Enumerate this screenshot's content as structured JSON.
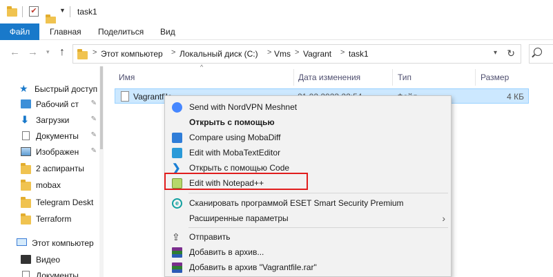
{
  "window": {
    "title": "task1"
  },
  "ribbon": {
    "tabs": [
      "Файл",
      "Главная",
      "Поделиться",
      "Вид"
    ]
  },
  "address": {
    "crumbs": [
      "Этот компьютер",
      "Локальный диск (C:)",
      "Vms",
      "Vagrant",
      "task1"
    ]
  },
  "sidebar": {
    "items": [
      {
        "label": "Быстрый доступ",
        "icon": "star-icon",
        "pinned": false
      },
      {
        "label": "Рабочий ст",
        "icon": "desktop-icon",
        "pinned": true
      },
      {
        "label": "Загрузки",
        "icon": "download-icon",
        "pinned": true
      },
      {
        "label": "Документы",
        "icon": "document-icon",
        "pinned": true
      },
      {
        "label": "Изображен",
        "icon": "image-icon",
        "pinned": true
      },
      {
        "label": "2 аспиранты",
        "icon": "folder-icon",
        "pinned": false
      },
      {
        "label": "mobax",
        "icon": "folder-icon",
        "pinned": false
      },
      {
        "label": "Telegram Deskt",
        "icon": "folder-icon",
        "pinned": false
      },
      {
        "label": "Terraform",
        "icon": "folder-icon",
        "pinned": false
      },
      {
        "label": "Этот компьютер",
        "icon": "computer-icon",
        "pinned": false
      },
      {
        "label": "Видео",
        "icon": "video-icon",
        "pinned": false
      },
      {
        "label": "Документы",
        "icon": "document-icon",
        "pinned": false
      }
    ],
    "pin_glyph": "📌"
  },
  "columns": {
    "name": "Имя",
    "date": "Дата изменения",
    "type": "Тип",
    "size": "Размер"
  },
  "files": [
    {
      "name": "Vagrantfile",
      "date": "21.02.2023 22:54",
      "type": "Файл",
      "size": "4 КБ"
    }
  ],
  "context_menu": {
    "items": [
      {
        "label": "Send with NordVPN Meshnet",
        "icon": "nordvpn-icon",
        "bold": false
      },
      {
        "label": "Открыть с помощью",
        "icon": "",
        "bold": true
      },
      {
        "label": "Compare using MobaDiff",
        "icon": "mobadiff-icon",
        "bold": false
      },
      {
        "label": "Edit with MobaTextEditor",
        "icon": "mobatexteditor-icon",
        "bold": false
      },
      {
        "label": "Открыть с помощью Code",
        "icon": "vscode-icon",
        "bold": false
      },
      {
        "label": "Edit with Notepad++",
        "icon": "notepadpp-icon",
        "bold": false,
        "highlighted": true
      },
      {
        "label": "Сканировать программой ESET Smart Security Premium",
        "icon": "eset-icon",
        "bold": false
      },
      {
        "label": "Расширенные параметры",
        "icon": "",
        "bold": false,
        "submenu": true
      },
      {
        "label": "Отправить",
        "icon": "share-icon",
        "bold": false
      },
      {
        "label": "Добавить в архив...",
        "icon": "winrar-icon",
        "bold": false
      },
      {
        "label": "Добавить в архив \"Vagrantfile.rar\"",
        "icon": "winrar-icon",
        "bold": false
      }
    ],
    "highlight_color": "#e11d1d"
  },
  "colors": {
    "accent": "#1979ca",
    "selection": "#cce8ff",
    "menu_bg": "#f2f2f2"
  }
}
